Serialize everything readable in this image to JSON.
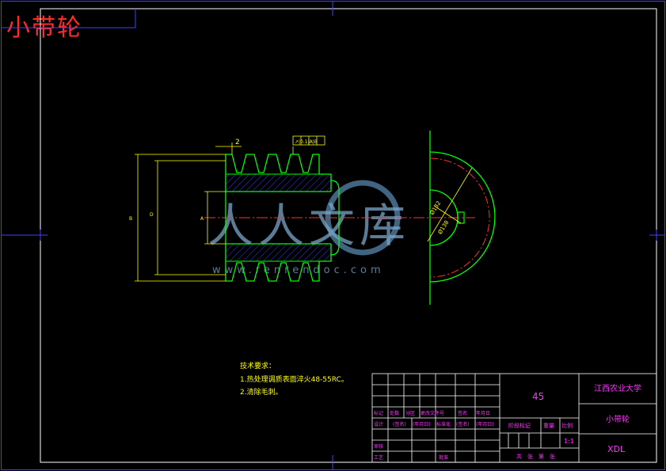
{
  "drawing_title": "小带轮",
  "dims": {
    "top_width": "2",
    "tolerance_frame": "↗|0.1|A|B",
    "left_outer": "B",
    "left_inner": "D",
    "bore": "A",
    "dia_132": "Ø132",
    "dia_138": "Ø138"
  },
  "notes": {
    "heading": "技术要求：",
    "line1": "1.热处理调质表面淬火48-55RC。",
    "line2": "2.清除毛刺。"
  },
  "watermark": {
    "main": "人人文库",
    "url": "www.renrendoc.com"
  },
  "title_block": {
    "material": "45",
    "school": "江西农业大学",
    "part_name": "小带轮",
    "code": "XDL",
    "labels": {
      "mark": "标记",
      "count": "处数",
      "zone": "分区",
      "doc_no": "更改文件号",
      "sign": "签名",
      "date": "年月日",
      "design": "设计",
      "sign_paren": "(签名)",
      "date_paren": "(年月日)",
      "standard": "标准化",
      "sign_paren2": "(签名)",
      "date_paren2": "(年月日)",
      "stage_mark": "阶段标记",
      "weight": "重量",
      "scale": "比例",
      "scale_val": "1:1",
      "review": "审核",
      "process": "工艺",
      "approve": "批准",
      "sheets": "共　张　第　张"
    }
  }
}
